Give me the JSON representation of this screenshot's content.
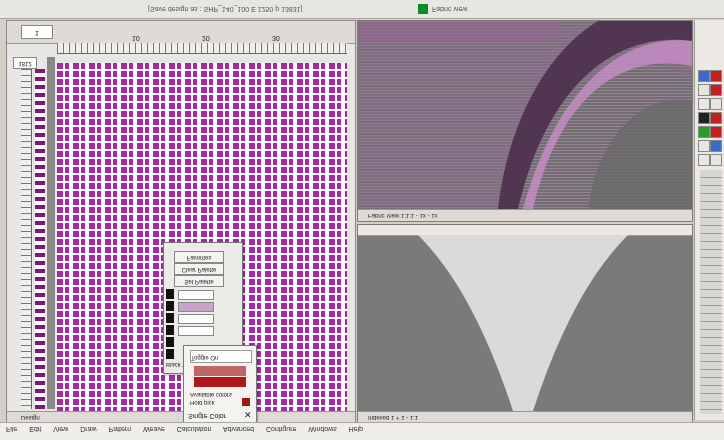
{
  "status_bar": {
    "document_label": "[Save design as : SHP_140_100 E 1250 p 13831]",
    "indicator_label": "Fabric view",
    "indicator_color": "#0a8a2a"
  },
  "design_window": {
    "page_value": "1",
    "width_value": "1812",
    "ruler_labels": [
      "10",
      "20",
      "30"
    ],
    "footer_label": "Design"
  },
  "palette_dialog": {
    "title": "Favorites",
    "clear_button": "Clear Palette",
    "set_button": "Set Palette",
    "count_label": "Black W"
  },
  "color_dialog": {
    "title": "Single Color",
    "toggle_label": "Toggle On",
    "available_label": "Available colors",
    "current_label": "Current selected color",
    "hold_label": "Hold pick",
    "swatch_colors": [
      "#c26468",
      "#b0171b"
    ],
    "close_glyph": "✕"
  },
  "fabric_view": {
    "footer_label": "Fabric View 1:1:1 - 1x - 1x"
  },
  "curve_view": {
    "footer_label": "Indexed 1 + 1 - 1:1"
  },
  "menu": {
    "items": [
      "File",
      "Edit",
      "View",
      "Draw",
      "Pattern",
      "Weave",
      "Calculation",
      "Advanced",
      "Configure",
      "Windows",
      "Help"
    ]
  },
  "colors": {
    "weave_purple": "#a42aa4",
    "tieup_purple": "#7a1a7a",
    "fabric_gray": "#7a7a7a",
    "curve_light": "#d8d8d8"
  }
}
